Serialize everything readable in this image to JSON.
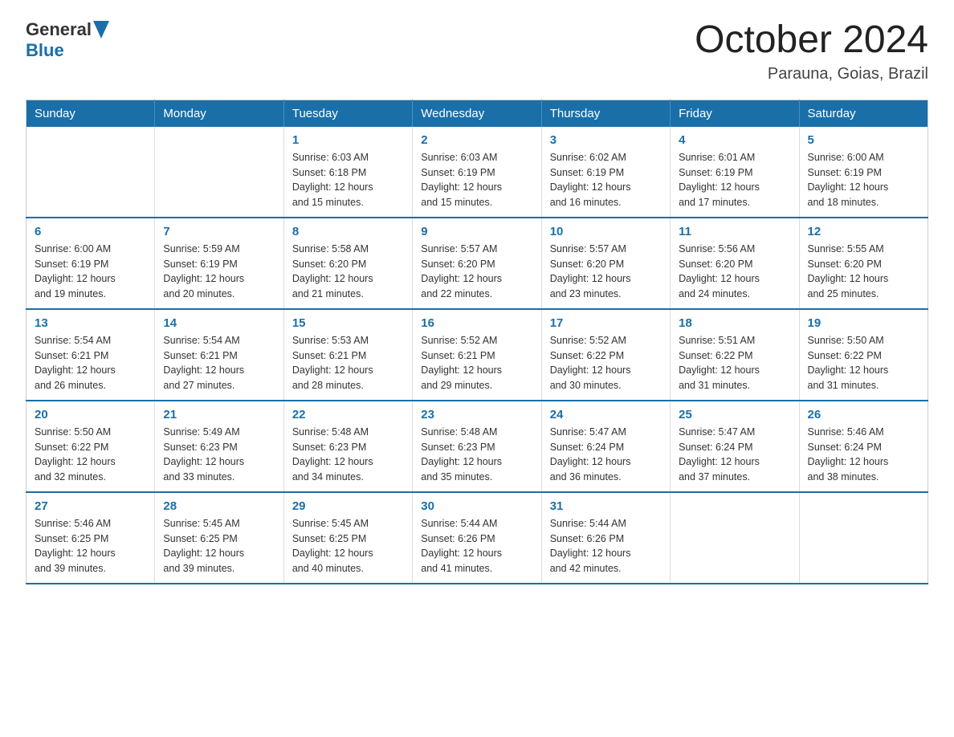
{
  "header": {
    "logo_general": "General",
    "logo_blue": "Blue",
    "title": "October 2024",
    "subtitle": "Parauna, Goias, Brazil"
  },
  "weekdays": [
    "Sunday",
    "Monday",
    "Tuesday",
    "Wednesday",
    "Thursday",
    "Friday",
    "Saturday"
  ],
  "weeks": [
    [
      {
        "day": "",
        "info": ""
      },
      {
        "day": "",
        "info": ""
      },
      {
        "day": "1",
        "info": "Sunrise: 6:03 AM\nSunset: 6:18 PM\nDaylight: 12 hours\nand 15 minutes."
      },
      {
        "day": "2",
        "info": "Sunrise: 6:03 AM\nSunset: 6:19 PM\nDaylight: 12 hours\nand 15 minutes."
      },
      {
        "day": "3",
        "info": "Sunrise: 6:02 AM\nSunset: 6:19 PM\nDaylight: 12 hours\nand 16 minutes."
      },
      {
        "day": "4",
        "info": "Sunrise: 6:01 AM\nSunset: 6:19 PM\nDaylight: 12 hours\nand 17 minutes."
      },
      {
        "day": "5",
        "info": "Sunrise: 6:00 AM\nSunset: 6:19 PM\nDaylight: 12 hours\nand 18 minutes."
      }
    ],
    [
      {
        "day": "6",
        "info": "Sunrise: 6:00 AM\nSunset: 6:19 PM\nDaylight: 12 hours\nand 19 minutes."
      },
      {
        "day": "7",
        "info": "Sunrise: 5:59 AM\nSunset: 6:19 PM\nDaylight: 12 hours\nand 20 minutes."
      },
      {
        "day": "8",
        "info": "Sunrise: 5:58 AM\nSunset: 6:20 PM\nDaylight: 12 hours\nand 21 minutes."
      },
      {
        "day": "9",
        "info": "Sunrise: 5:57 AM\nSunset: 6:20 PM\nDaylight: 12 hours\nand 22 minutes."
      },
      {
        "day": "10",
        "info": "Sunrise: 5:57 AM\nSunset: 6:20 PM\nDaylight: 12 hours\nand 23 minutes."
      },
      {
        "day": "11",
        "info": "Sunrise: 5:56 AM\nSunset: 6:20 PM\nDaylight: 12 hours\nand 24 minutes."
      },
      {
        "day": "12",
        "info": "Sunrise: 5:55 AM\nSunset: 6:20 PM\nDaylight: 12 hours\nand 25 minutes."
      }
    ],
    [
      {
        "day": "13",
        "info": "Sunrise: 5:54 AM\nSunset: 6:21 PM\nDaylight: 12 hours\nand 26 minutes."
      },
      {
        "day": "14",
        "info": "Sunrise: 5:54 AM\nSunset: 6:21 PM\nDaylight: 12 hours\nand 27 minutes."
      },
      {
        "day": "15",
        "info": "Sunrise: 5:53 AM\nSunset: 6:21 PM\nDaylight: 12 hours\nand 28 minutes."
      },
      {
        "day": "16",
        "info": "Sunrise: 5:52 AM\nSunset: 6:21 PM\nDaylight: 12 hours\nand 29 minutes."
      },
      {
        "day": "17",
        "info": "Sunrise: 5:52 AM\nSunset: 6:22 PM\nDaylight: 12 hours\nand 30 minutes."
      },
      {
        "day": "18",
        "info": "Sunrise: 5:51 AM\nSunset: 6:22 PM\nDaylight: 12 hours\nand 31 minutes."
      },
      {
        "day": "19",
        "info": "Sunrise: 5:50 AM\nSunset: 6:22 PM\nDaylight: 12 hours\nand 31 minutes."
      }
    ],
    [
      {
        "day": "20",
        "info": "Sunrise: 5:50 AM\nSunset: 6:22 PM\nDaylight: 12 hours\nand 32 minutes."
      },
      {
        "day": "21",
        "info": "Sunrise: 5:49 AM\nSunset: 6:23 PM\nDaylight: 12 hours\nand 33 minutes."
      },
      {
        "day": "22",
        "info": "Sunrise: 5:48 AM\nSunset: 6:23 PM\nDaylight: 12 hours\nand 34 minutes."
      },
      {
        "day": "23",
        "info": "Sunrise: 5:48 AM\nSunset: 6:23 PM\nDaylight: 12 hours\nand 35 minutes."
      },
      {
        "day": "24",
        "info": "Sunrise: 5:47 AM\nSunset: 6:24 PM\nDaylight: 12 hours\nand 36 minutes."
      },
      {
        "day": "25",
        "info": "Sunrise: 5:47 AM\nSunset: 6:24 PM\nDaylight: 12 hours\nand 37 minutes."
      },
      {
        "day": "26",
        "info": "Sunrise: 5:46 AM\nSunset: 6:24 PM\nDaylight: 12 hours\nand 38 minutes."
      }
    ],
    [
      {
        "day": "27",
        "info": "Sunrise: 5:46 AM\nSunset: 6:25 PM\nDaylight: 12 hours\nand 39 minutes."
      },
      {
        "day": "28",
        "info": "Sunrise: 5:45 AM\nSunset: 6:25 PM\nDaylight: 12 hours\nand 39 minutes."
      },
      {
        "day": "29",
        "info": "Sunrise: 5:45 AM\nSunset: 6:25 PM\nDaylight: 12 hours\nand 40 minutes."
      },
      {
        "day": "30",
        "info": "Sunrise: 5:44 AM\nSunset: 6:26 PM\nDaylight: 12 hours\nand 41 minutes."
      },
      {
        "day": "31",
        "info": "Sunrise: 5:44 AM\nSunset: 6:26 PM\nDaylight: 12 hours\nand 42 minutes."
      },
      {
        "day": "",
        "info": ""
      },
      {
        "day": "",
        "info": ""
      }
    ]
  ]
}
